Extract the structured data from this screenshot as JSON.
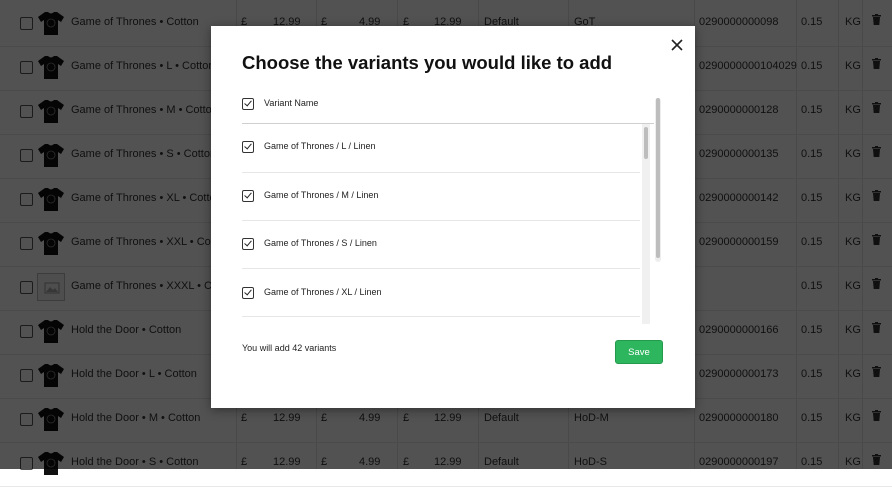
{
  "background_table": {
    "rows": [
      {
        "name": "Game of Thrones • Cotton",
        "c1": "£",
        "c2": "12.99",
        "c3": "£",
        "c4": "4.99",
        "c5": "£",
        "c6": "12.99",
        "c7": "Default",
        "c8": "GoT",
        "barcode": "0290000000098",
        "weight": "0.15",
        "unit": "KG",
        "image": true
      },
      {
        "name": "Game of Thrones • L • Cotton",
        "c1": "",
        "c2": "",
        "c3": "",
        "c4": "",
        "c5": "",
        "c6": "",
        "c7": "",
        "c8": "",
        "barcode": "0290000000104029",
        "weight": "0.15",
        "unit": "KG",
        "image": true
      },
      {
        "name": "Game of Thrones • M • Cotton",
        "c1": "",
        "c2": "",
        "c3": "",
        "c4": "",
        "c5": "",
        "c6": "",
        "c7": "",
        "c8": "",
        "barcode": "0290000000128",
        "weight": "0.15",
        "unit": "KG",
        "image": true
      },
      {
        "name": "Game of Thrones • S • Cotton",
        "c1": "",
        "c2": "",
        "c3": "",
        "c4": "",
        "c5": "",
        "c6": "",
        "c7": "",
        "c8": "",
        "barcode": "0290000000135",
        "weight": "0.15",
        "unit": "KG",
        "image": true
      },
      {
        "name": "Game of Thrones • XL • Cotton",
        "c1": "",
        "c2": "",
        "c3": "",
        "c4": "",
        "c5": "",
        "c6": "",
        "c7": "",
        "c8": "",
        "barcode": "0290000000142",
        "weight": "0.15",
        "unit": "KG",
        "image": true
      },
      {
        "name": "Game of Thrones • XXL • Cotton",
        "c1": "",
        "c2": "",
        "c3": "",
        "c4": "",
        "c5": "",
        "c6": "",
        "c7": "",
        "c8": "",
        "barcode": "0290000000159",
        "weight": "0.15",
        "unit": "KG",
        "image": true
      },
      {
        "name": "Game of Thrones • XXXL • Cotton",
        "c1": "",
        "c2": "",
        "c3": "",
        "c4": "",
        "c5": "",
        "c6": "",
        "c7": "",
        "c8": "",
        "barcode": "",
        "weight": "0.15",
        "unit": "KG",
        "image": false
      },
      {
        "name": "Hold the Door • Cotton",
        "c1": "",
        "c2": "",
        "c3": "",
        "c4": "",
        "c5": "",
        "c6": "",
        "c7": "",
        "c8": "",
        "barcode": "0290000000166",
        "weight": "0.15",
        "unit": "KG",
        "image": true
      },
      {
        "name": "Hold the Door • L • Cotton",
        "c1": "",
        "c2": "",
        "c3": "",
        "c4": "",
        "c5": "",
        "c6": "",
        "c7": "",
        "c8": "",
        "barcode": "0290000000173",
        "weight": "0.15",
        "unit": "KG",
        "image": true
      },
      {
        "name": "Hold the Door • M • Cotton",
        "c1": "£",
        "c2": "12.99",
        "c3": "£",
        "c4": "4.99",
        "c5": "£",
        "c6": "12.99",
        "c7": "Default",
        "c8": "HoD-M",
        "barcode": "0290000000180",
        "weight": "0.15",
        "unit": "KG",
        "image": true
      },
      {
        "name": "Hold the Door • S • Cotton",
        "c1": "£",
        "c2": "12.99",
        "c3": "£",
        "c4": "4.99",
        "c5": "£",
        "c6": "12.99",
        "c7": "Default",
        "c8": "HoD-S",
        "barcode": "0290000000197",
        "weight": "0.15",
        "unit": "KG",
        "image": true
      }
    ]
  },
  "modal": {
    "title": "Choose the variants you would like to add",
    "close_icon": "close-icon",
    "header_label": "Variant Name",
    "variants": [
      "Game of Thrones / L / Linen",
      "Game of Thrones / M / Linen",
      "Game of Thrones / S / Linen",
      "Game of Thrones / XL / Linen"
    ],
    "footer_text": "You will add 42 variants",
    "save_label": "Save"
  },
  "colors": {
    "overlay": "#000000",
    "save_button": "#2eb65e"
  }
}
